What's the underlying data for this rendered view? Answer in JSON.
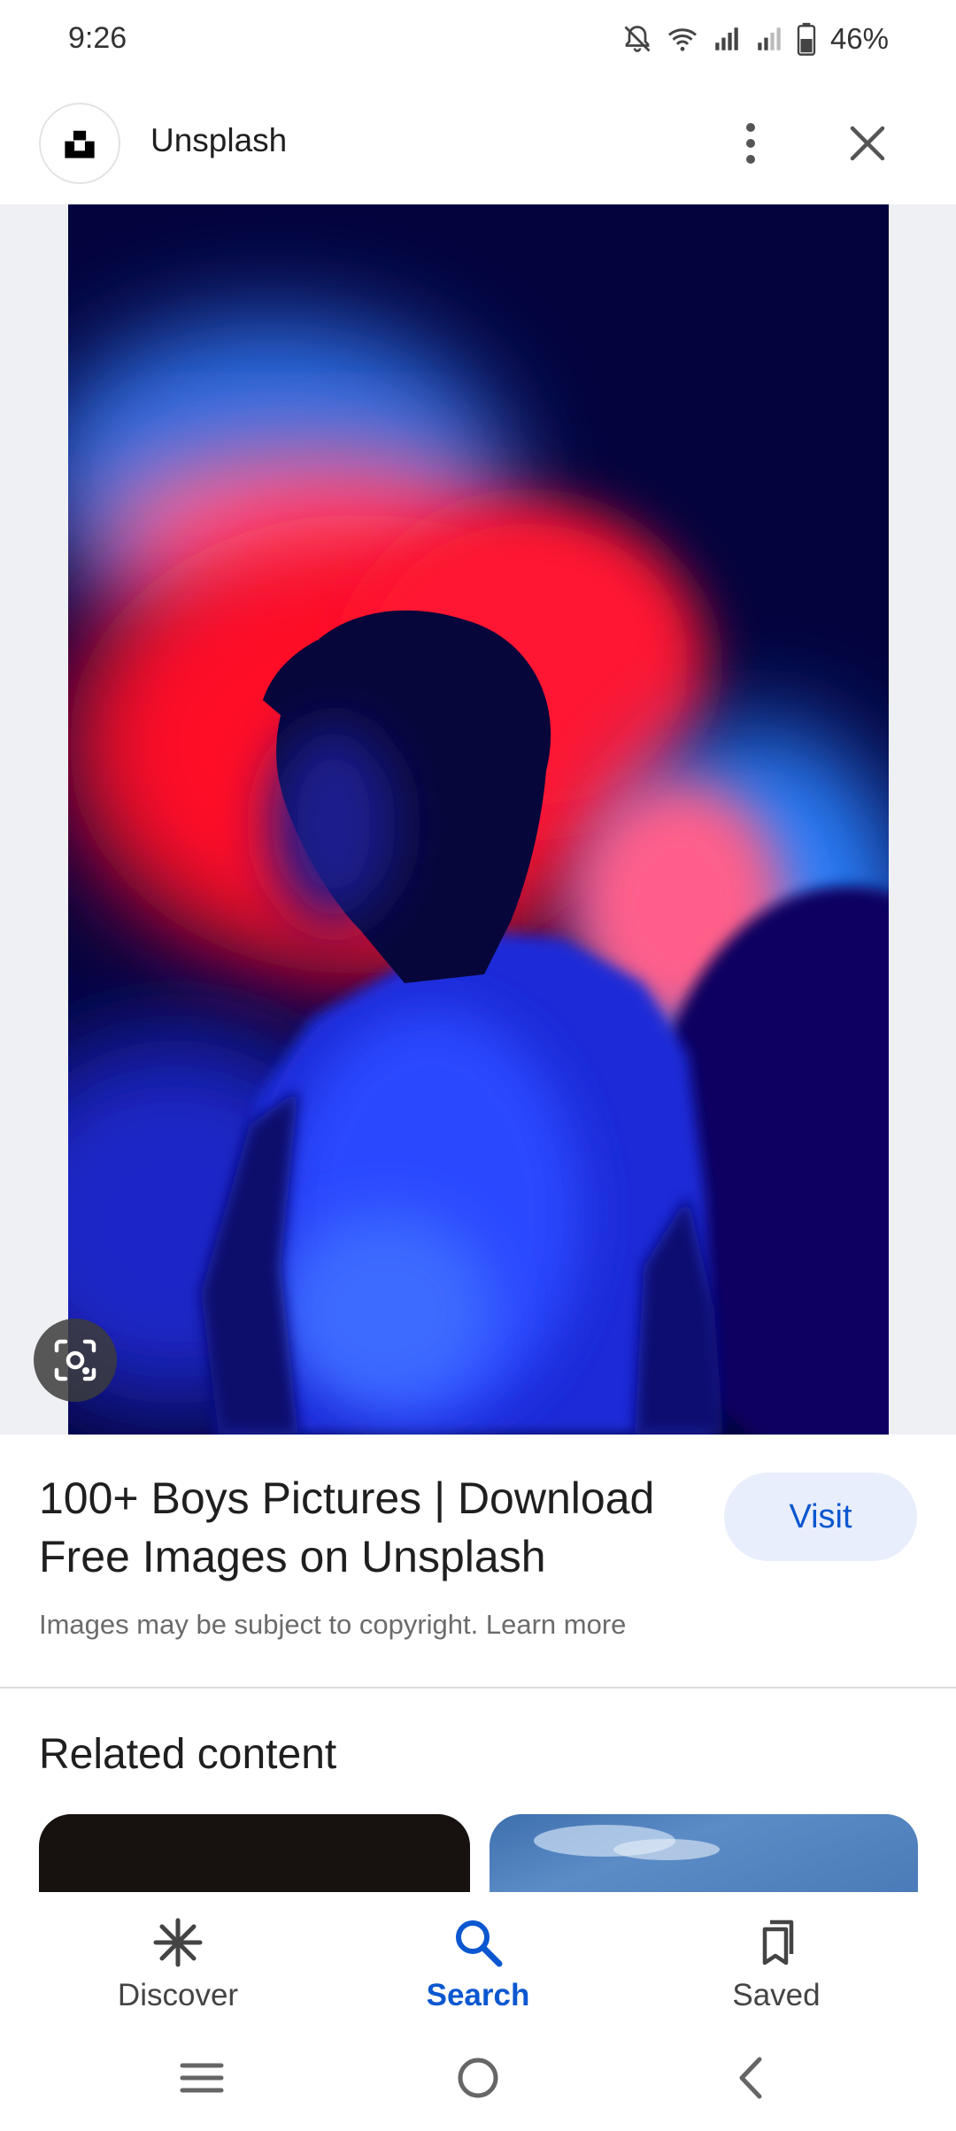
{
  "status_bar": {
    "time": "9:26",
    "battery": "46%",
    "icons": [
      "mute-icon",
      "wifi-icon",
      "signal-icon",
      "signal-icon",
      "battery-icon"
    ]
  },
  "header": {
    "site_name": "Unsplash",
    "logo_icon": "unsplash-logo-icon",
    "more_icon": "more-vert-icon",
    "close_icon": "close-icon"
  },
  "image": {
    "lens_icon": "lens-search-icon"
  },
  "result": {
    "title": "100+ Boys Pictures | Download Free Images on Unsplash",
    "visit_label": "Visit",
    "copyright_note": "Images may be subject to copyright. Learn more"
  },
  "related": {
    "heading": "Related content"
  },
  "bottom_nav": {
    "items": [
      {
        "label": "Discover",
        "icon": "discover-icon",
        "active": false
      },
      {
        "label": "Search",
        "icon": "search-icon",
        "active": true
      },
      {
        "label": "Saved",
        "icon": "saved-icon",
        "active": false
      }
    ]
  },
  "system_nav": {
    "icons": [
      "recents-icon",
      "home-icon",
      "back-icon"
    ]
  },
  "colors": {
    "accent": "#0b57d0",
    "visit_bg": "#e8eefb",
    "image_bg": "#eef0f3"
  }
}
